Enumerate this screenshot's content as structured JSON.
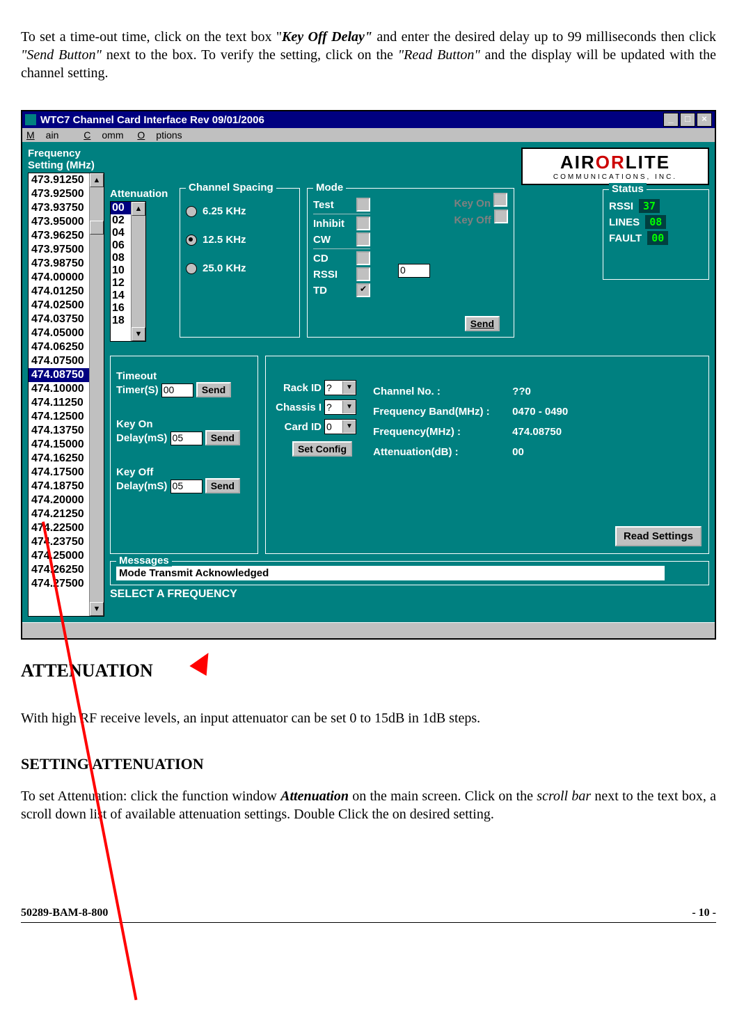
{
  "intro": {
    "pre": "To set a time-out time, click on the text box \"",
    "keyoff": "Key Off Delay\"",
    "mid1": " and enter the desired delay up to 99 milliseconds then click ",
    "send": "\"Send Button\"",
    "mid2": " next to the box. To verify the setting, click on the ",
    "read": "\"Read Button\"",
    "end": " and the display will be updated with the channel setting."
  },
  "window": {
    "title": "WTC7 Channel Card Interface Rev 09/01/2006",
    "menu": {
      "main": "Main",
      "comm": "Comm",
      "options": "Options"
    },
    "min": "_",
    "max": "□",
    "close": "×"
  },
  "freq": {
    "title": "Frequency Setting (MHz)",
    "items": [
      "473.91250",
      "473.92500",
      "473.93750",
      "473.95000",
      "473.96250",
      "473.97500",
      "473.98750",
      "474.00000",
      "474.01250",
      "474.02500",
      "474.03750",
      "474.05000",
      "474.06250",
      "474.07500",
      "474.08750",
      "474.10000",
      "474.11250",
      "474.12500",
      "474.13750",
      "474.15000",
      "474.16250",
      "474.17500",
      "474.18750",
      "474.20000",
      "474.21250",
      "474.22500",
      "474.23750",
      "474.25000",
      "474.26250",
      "474.27500"
    ],
    "selected_index": 14
  },
  "atten": {
    "title": "Attenuation",
    "items": [
      "00",
      "02",
      "04",
      "06",
      "08",
      "10",
      "12",
      "14",
      "16",
      "18"
    ],
    "selected_index": 0
  },
  "spacing": {
    "title": "Channel Spacing",
    "opts": [
      "6.25 KHz",
      "12.5 KHz",
      "25.0 KHz"
    ],
    "selected_index": 1
  },
  "mode": {
    "title": "Mode",
    "rows": [
      {
        "label": "Test",
        "checked": false
      },
      {
        "label": "Inhibit",
        "checked": false
      },
      {
        "label": "CW",
        "checked": false
      },
      {
        "label": "CD",
        "checked": false
      },
      {
        "label": "RSSI",
        "checked": false
      },
      {
        "label": "TD",
        "checked": true
      }
    ],
    "key_on": "Key On",
    "key_off": "Key Off",
    "rssi_val": "0",
    "send": "Send"
  },
  "status": {
    "title": "Status",
    "rssi_l": "RSSI",
    "rssi_v": "37",
    "lines_l": "LINES",
    "lines_v": "08",
    "fault_l": "FAULT",
    "fault_v": "00"
  },
  "timers": {
    "timeout_l1": "Timeout",
    "timeout_l2": "Timer(S)",
    "timeout_v": "00",
    "keyon_l1": "Key On",
    "keyon_l2": "Delay(mS)",
    "keyon_v": "05",
    "keyoff_l1": "Key Off",
    "keyoff_l2": "Delay(mS)",
    "keyoff_v": "05",
    "send": "Send"
  },
  "config": {
    "rack_l": "Rack ID",
    "rack_v": "?",
    "chassis_l": "Chassis I",
    "chassis_v": "?",
    "card_l": "Card ID",
    "card_v": "0",
    "set": "Set Config",
    "chno_l": "Channel No. :",
    "chno_v": "??0",
    "band_l": "Frequency Band(MHz) :",
    "band_v": "0470 - 0490",
    "freq_l": "Frequency(MHz) :",
    "freq_v": "474.08750",
    "att_l": "Attenuation(dB) :",
    "att_v": "00",
    "read": "Read Settings"
  },
  "messages": {
    "title": "Messages",
    "text": "Mode Transmit Acknowledged",
    "select": "SELECT A FREQUENCY"
  },
  "logo": {
    "air": "AIR",
    "or": "OR",
    "lite": "LITE",
    "sub": "COMMUNICATIONS, INC."
  },
  "h2": "ATTENUATION",
  "p1": "With high RF receive levels, an input attenuator can be set 0 to 15dB in 1dB steps.",
  "h3": "SETTING ATTENUATION",
  "p2": {
    "pre": "To set Attenuation: click the function window ",
    "atten": "Attenuation",
    "mid": " on the main screen. Click on the ",
    "scroll": "scroll bar",
    "end": " next to the text box, a scroll down list of available attenuation settings.  Double Click the on desired setting."
  },
  "footer": {
    "left": "50289-BAM-8-800",
    "right": "- 10 -"
  }
}
